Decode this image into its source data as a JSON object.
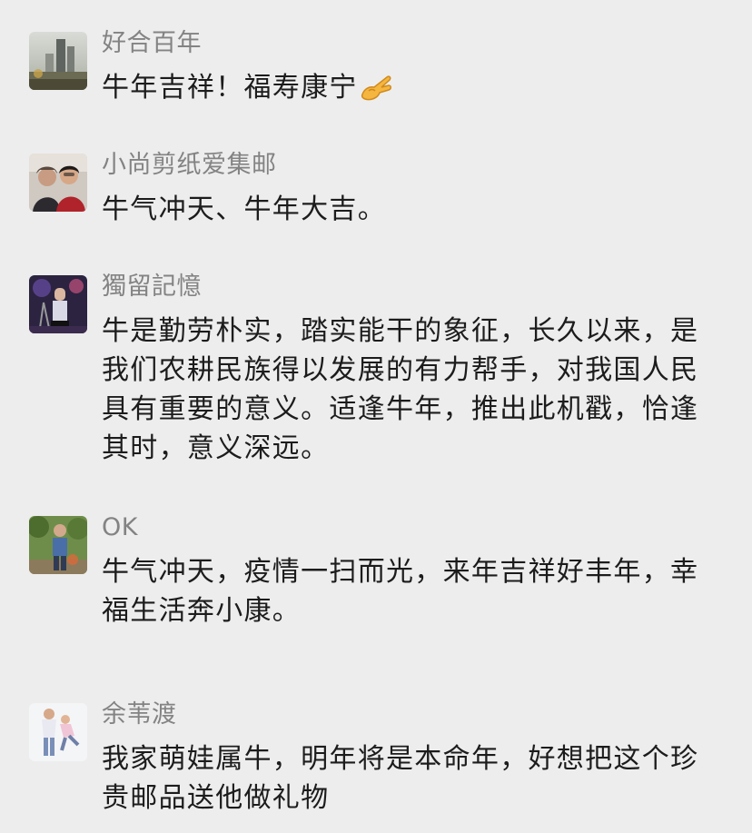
{
  "comments": [
    {
      "nickname": "好合百年",
      "text": "牛年吉祥！福寿康宁",
      "emoji": "ok-hand-icon"
    },
    {
      "nickname": "小尚剪纸爱集邮",
      "text": "牛气冲天、牛年大吉。"
    },
    {
      "nickname": "獨留記憶",
      "text": "牛是勤劳朴实，踏实能干的象征，长久以来，是我们农耕民族得以发展的有力帮手，对我国人民具有重要的意义。适逢牛年，推出此机戳，恰逢其时，意义深远。"
    },
    {
      "nickname": "OK",
      "text": "牛气冲天，疫情一扫而光，来年吉祥好丰年，幸福生活奔小康。"
    },
    {
      "nickname": "余苇渡",
      "text": "我家萌娃属牛，明年将是本命年，好想把这个珍贵邮品送他做礼物"
    }
  ],
  "colors": {
    "background": "#ededed",
    "nickname": "#838383",
    "text": "#1c1c1c"
  }
}
